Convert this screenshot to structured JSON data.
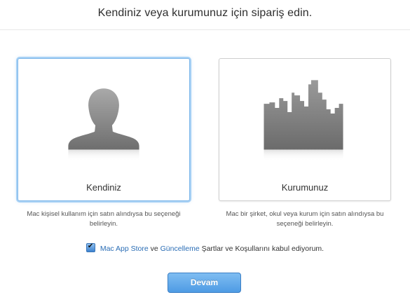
{
  "header": {
    "title": "Kendiniz veya kurumunuz için sipariş edin."
  },
  "options": {
    "personal": {
      "label": "Kendiniz",
      "description": "Mac kişisel kullanım için satın alındıysa bu seçeneği belirleyin.",
      "icon": "person-silhouette-icon",
      "selected": true
    },
    "organization": {
      "label": "Kurumunuz",
      "description": "Mac bir şirket, okul veya kurum için satın alındıysa bu seçeneği belirleyin.",
      "icon": "city-skyline-icon",
      "selected": false
    }
  },
  "agreement": {
    "checked": true,
    "link_app_store": "Mac App Store",
    "conj": "ve",
    "link_update": "Güncelleme",
    "suffix": "Şartlar ve Koşullarını kabul ediyorum."
  },
  "continue_button": {
    "label": "Devam"
  },
  "colors": {
    "accent": "#4e9be4",
    "link": "#2a6db5",
    "selection": "#7fb8ea"
  }
}
